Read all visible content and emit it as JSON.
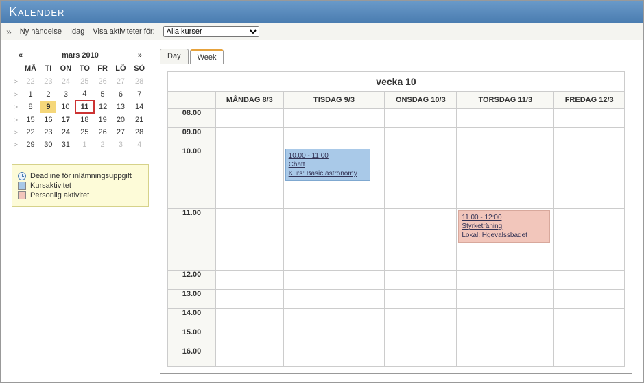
{
  "header": {
    "title": "Kalender"
  },
  "toolbar": {
    "new_event": "Ny händelse",
    "today": "Idag",
    "filter_label": "Visa aktiviteter för:",
    "filter_value": "Alla kurser"
  },
  "minical": {
    "prev": "«",
    "next": "»",
    "month_label": "mars 2010",
    "dow": [
      "MÅ",
      "TI",
      "ON",
      "TO",
      "FR",
      "LÖ",
      "SÖ"
    ],
    "rows": [
      {
        "wk": ">",
        "days": [
          {
            "n": "22",
            "dim": true
          },
          {
            "n": "23",
            "dim": true
          },
          {
            "n": "24",
            "dim": true
          },
          {
            "n": "25",
            "dim": true
          },
          {
            "n": "26",
            "dim": true
          },
          {
            "n": "27",
            "dim": true
          },
          {
            "n": "28",
            "dim": true
          }
        ]
      },
      {
        "wk": ">",
        "days": [
          {
            "n": "1"
          },
          {
            "n": "2"
          },
          {
            "n": "3"
          },
          {
            "n": "4"
          },
          {
            "n": "5"
          },
          {
            "n": "6"
          },
          {
            "n": "7"
          }
        ]
      },
      {
        "wk": ">",
        "days": [
          {
            "n": "8"
          },
          {
            "n": "9",
            "highlight": true
          },
          {
            "n": "10"
          },
          {
            "n": "11",
            "today": true
          },
          {
            "n": "12"
          },
          {
            "n": "13"
          },
          {
            "n": "14"
          }
        ]
      },
      {
        "wk": ">",
        "days": [
          {
            "n": "15"
          },
          {
            "n": "16"
          },
          {
            "n": "17",
            "bold": true
          },
          {
            "n": "18"
          },
          {
            "n": "19"
          },
          {
            "n": "20"
          },
          {
            "n": "21"
          }
        ]
      },
      {
        "wk": ">",
        "days": [
          {
            "n": "22"
          },
          {
            "n": "23"
          },
          {
            "n": "24"
          },
          {
            "n": "25"
          },
          {
            "n": "26"
          },
          {
            "n": "27"
          },
          {
            "n": "28"
          }
        ]
      },
      {
        "wk": ">",
        "days": [
          {
            "n": "29"
          },
          {
            "n": "30"
          },
          {
            "n": "31"
          },
          {
            "n": "1",
            "dim": true
          },
          {
            "n": "2",
            "dim": true
          },
          {
            "n": "3",
            "dim": true
          },
          {
            "n": "4",
            "dim": true
          }
        ]
      }
    ]
  },
  "legend": {
    "deadline": "Deadline för inlämningsuppgift",
    "course": "Kursaktivitet",
    "personal": "Personlig aktivitet"
  },
  "tabs": {
    "day": "Day",
    "week": "Week"
  },
  "week": {
    "title": "vecka 10",
    "days": [
      "MÅNDAG 8/3",
      "TISDAG 9/3",
      "ONSDAG 10/3",
      "TORSDAG 11/3",
      "FREDAG 12/3"
    ],
    "hours": [
      "08.00",
      "09.00",
      "10.00",
      "11.00",
      "12.00",
      "13.00",
      "14.00",
      "15.00",
      "16.00"
    ],
    "events": {
      "tue_10": "10.00 - 11:00\nChatt\nKurs: Basic astronomy",
      "thu_11": "11.00 - 12:00\nStyrketräning\nLokal: Hgevalssbadet"
    }
  }
}
